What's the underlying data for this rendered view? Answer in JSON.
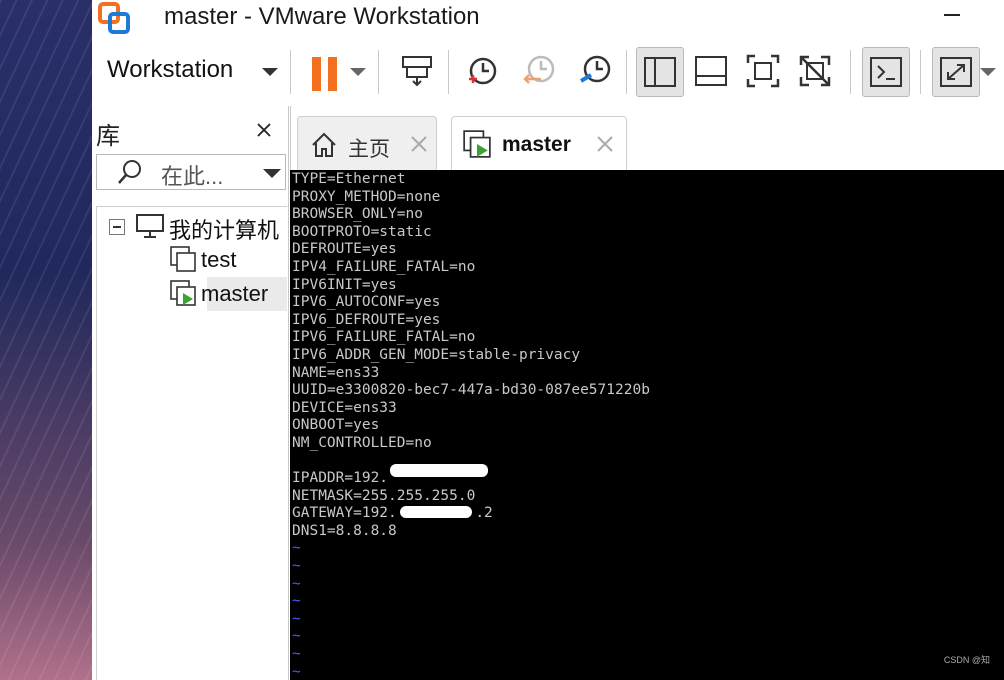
{
  "window": {
    "title": "master - VMware Workstation"
  },
  "toolbar": {
    "menu_label": "Workstation",
    "buttons": [
      {
        "icon": "pause-icon"
      },
      {
        "icon": "send-keys-icon"
      },
      {
        "icon": "snapshot-take-icon"
      },
      {
        "icon": "snapshot-revert-icon"
      },
      {
        "icon": "snapshot-manager-icon"
      },
      {
        "icon": "show-library-icon"
      },
      {
        "icon": "thumbnail-bar-icon"
      },
      {
        "icon": "fullscreen-icon"
      },
      {
        "icon": "unity-icon"
      },
      {
        "icon": "console-view-icon"
      },
      {
        "icon": "stretch-guest-icon"
      }
    ]
  },
  "library": {
    "title": "库",
    "search_placeholder": "在此...",
    "tree": {
      "root_label": "我的计算机",
      "items": [
        {
          "label": "test",
          "icon": "vm-icon"
        },
        {
          "label": "master",
          "icon": "vm-running-icon",
          "selected": true
        }
      ]
    }
  },
  "tabs": [
    {
      "label": "主页",
      "icon": "home-icon"
    },
    {
      "label": "master",
      "icon": "vm-running-icon",
      "active": true
    }
  ],
  "console": {
    "lines": [
      "TYPE=Ethernet",
      "PROXY_METHOD=none",
      "BROWSER_ONLY=no",
      "BOOTPROTO=static",
      "DEFROUTE=yes",
      "IPV4_FAILURE_FATAL=no",
      "IPV6INIT=yes",
      "IPV6_AUTOCONF=yes",
      "IPV6_DEFROUTE=yes",
      "IPV6_FAILURE_FATAL=no",
      "IPV6_ADDR_GEN_MODE=stable-privacy",
      "NAME=ens33",
      "UUID=e3300820-bec7-447a-bd30-087ee571220b",
      "DEVICE=ens33",
      "ONBOOT=yes",
      "NM_CONTROLLED=no",
      "",
      "IPADDR=192.",
      "NETMASK=255.255.255.0",
      "GATEWAY=192.         .2",
      "DNS1=8.8.8.8"
    ],
    "tilde_lines": [
      "~",
      "~",
      "~",
      "~",
      "~",
      "~",
      "~",
      "~"
    ],
    "colors": {
      "background": "#000000",
      "text": "#c8c8c8",
      "tilde": "#4a5cff"
    }
  },
  "watermark": "CSDN @知"
}
